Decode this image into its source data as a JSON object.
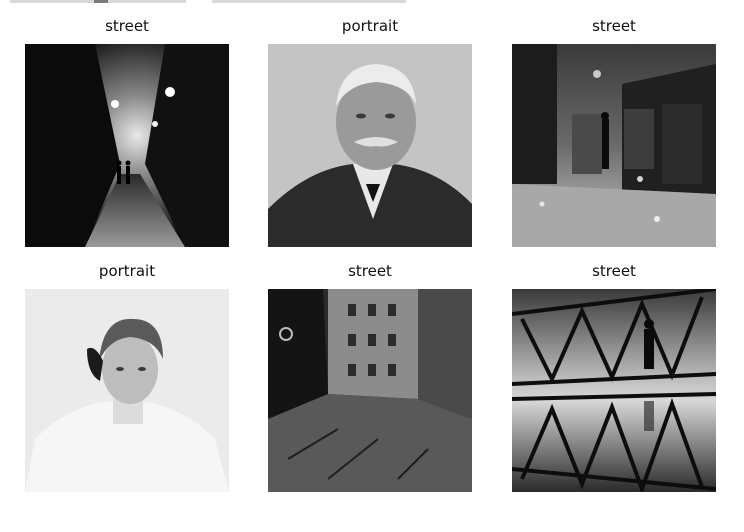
{
  "figure": {
    "panels": [
      {
        "label": "street"
      },
      {
        "label": "portrait"
      },
      {
        "label": "street"
      },
      {
        "label": "portrait"
      },
      {
        "label": "street"
      },
      {
        "label": "street"
      }
    ]
  }
}
